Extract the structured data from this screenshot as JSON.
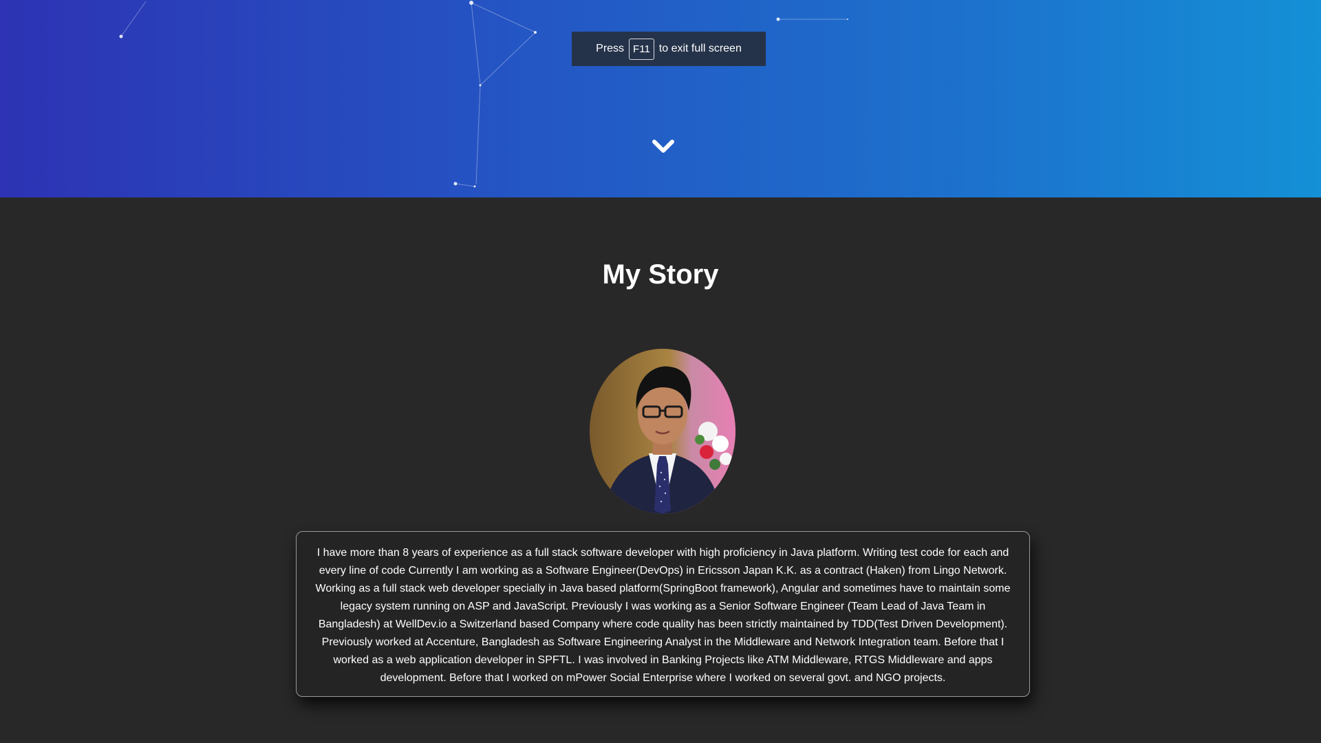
{
  "banner": {
    "press_label": "Press",
    "key_label": "F11",
    "suffix_label": "to exit full screen"
  },
  "story": {
    "title": "My Story",
    "body": "I have more than 8 years of experience as a full stack software developer with high proficiency in Java platform. Writing test code for each and every line of code Currently I am working as a Software Engineer(DevOps) in Ericsson Japan K.K. as a contract (Haken) from Lingo Network. Working as a full stack web developer specially in Java based platform(SpringBoot framework), Angular and sometimes have to maintain some legacy system running on ASP and JavaScript. Previously I was working as a Senior Software Engineer (Team Lead of Java Team in Bangladesh) at WellDev.io a Switzerland based Company where code quality has been strictly maintained by TDD(Test Driven Development). Previously worked at Accenture, Bangladesh as Software Engineering Analyst in the Middleware and Network Integration team. Before that I worked as a web application developer in SPFTL. I was involved in Banking Projects like ATM Middleware, RTGS Middleware and apps development. Before that I worked on mPower Social Enterprise where I worked on several govt. and NGO projects."
  },
  "icons": {
    "scroll_down": "chevron-down-icon",
    "avatar": "profile-photo"
  },
  "colors": {
    "hero_gradient_start": "#2d33b4",
    "hero_gradient_end": "#1490d6",
    "page_background": "#282828",
    "banner_background": "#25334a",
    "card_border": "#9a9a9a",
    "text": "#ffffff"
  }
}
